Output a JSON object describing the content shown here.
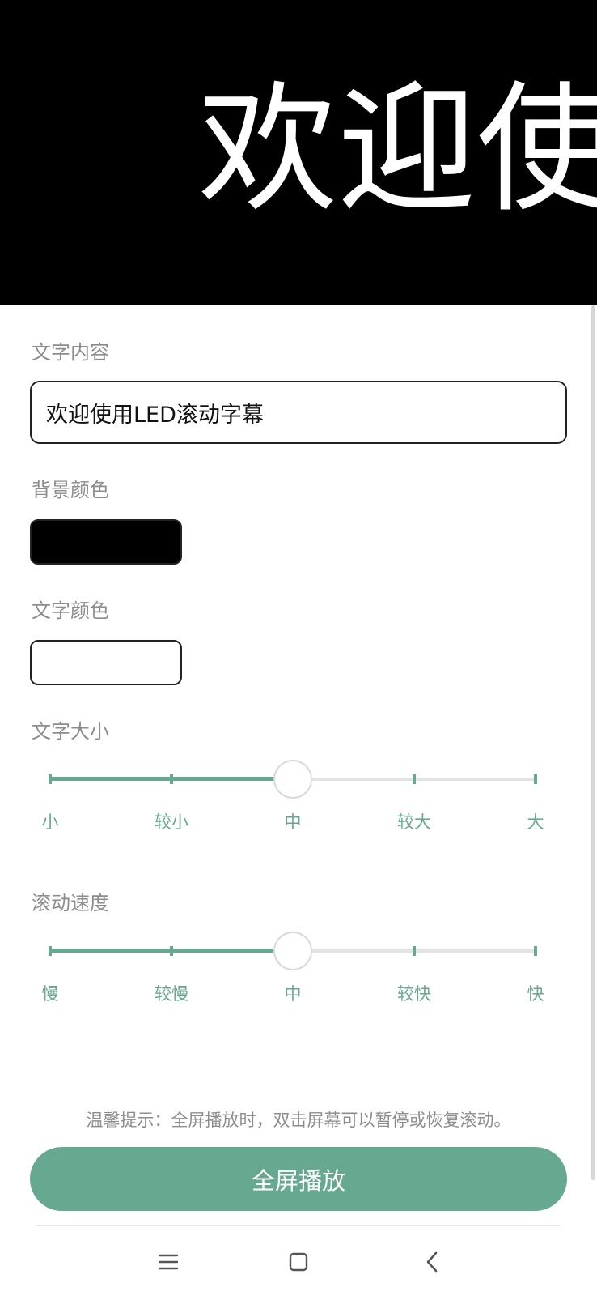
{
  "preview": {
    "text": "欢迎使"
  },
  "form": {
    "text_content_label": "文字内容",
    "text_content_value": "欢迎使用LED滚动字幕",
    "bg_color_label": "背景颜色",
    "bg_color": "#000000",
    "text_color_label": "文字颜色",
    "text_color": "#ffffff"
  },
  "size_slider": {
    "label": "文字大小",
    "marks": [
      "小",
      "较小",
      "中",
      "较大",
      "大"
    ],
    "value_index": 2
  },
  "speed_slider": {
    "label": "滚动速度",
    "marks": [
      "慢",
      "较慢",
      "中",
      "较快",
      "快"
    ],
    "value_index": 2
  },
  "tip": "温馨提示：全屏播放时，双击屏幕可以暂停或恢复滚动。",
  "play_button": "全屏播放",
  "nav": {
    "menu_icon": "menu-icon",
    "home_icon": "home-icon",
    "back_icon": "back-icon"
  },
  "colors": {
    "accent": "#67a990",
    "track": "#e3e3e3"
  }
}
